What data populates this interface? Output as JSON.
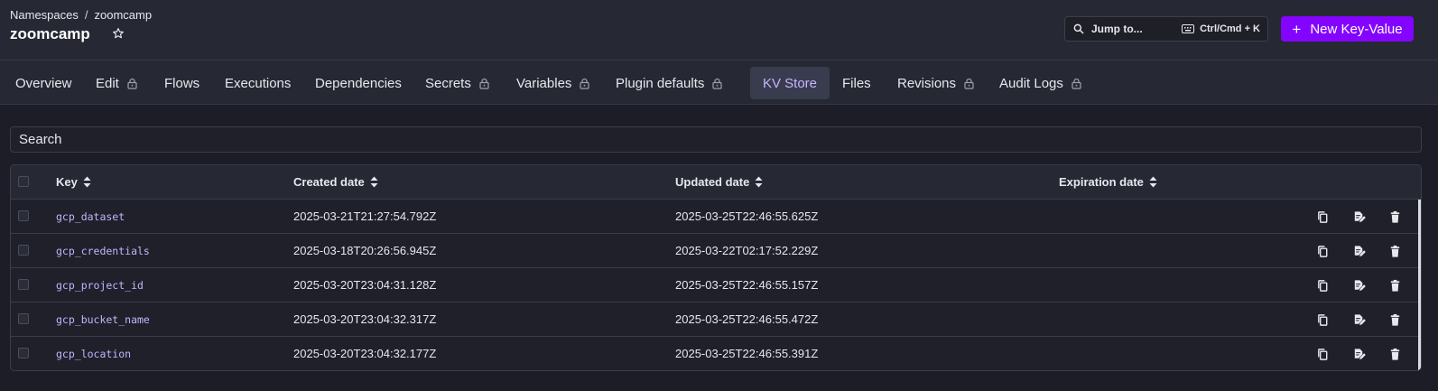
{
  "breadcrumb": {
    "root": "Namespaces",
    "separator": "/",
    "current": "zoomcamp"
  },
  "page": {
    "title": "zoomcamp",
    "favorite_icon": "star-icon"
  },
  "jump": {
    "label": "Jump to...",
    "shortcut": "Ctrl/Cmd + K",
    "icon": "search-icon",
    "keyboard_icon": "keyboard-icon"
  },
  "new_button": {
    "plus": "+",
    "label": "New Key-Value",
    "color": "#8405ff"
  },
  "tabs": [
    {
      "label": "Overview",
      "locked": false
    },
    {
      "label": "Edit",
      "locked": true
    },
    {
      "label": "Flows",
      "locked": false
    },
    {
      "label": "Executions",
      "locked": false
    },
    {
      "label": "Dependencies",
      "locked": false
    },
    {
      "label": "Secrets",
      "locked": true
    },
    {
      "label": "Variables",
      "locked": true
    },
    {
      "label": "Plugin defaults",
      "locked": true
    },
    {
      "label": "KV Store",
      "locked": false,
      "active": true
    },
    {
      "label": "Files",
      "locked": false
    },
    {
      "label": "Revisions",
      "locked": true
    },
    {
      "label": "Audit Logs",
      "locked": true
    }
  ],
  "search": {
    "placeholder": "Search"
  },
  "table": {
    "headers": {
      "key": "Key",
      "created": "Created date",
      "updated": "Updated date",
      "expiration": "Expiration date"
    },
    "rows": [
      {
        "key": "gcp_dataset",
        "created": "2025-03-21T21:27:54.792Z",
        "updated": "2025-03-25T22:46:55.625Z",
        "expiration": ""
      },
      {
        "key": "gcp_credentials",
        "created": "2025-03-18T20:26:56.945Z",
        "updated": "2025-03-22T02:17:52.229Z",
        "expiration": ""
      },
      {
        "key": "gcp_project_id",
        "created": "2025-03-20T23:04:31.128Z",
        "updated": "2025-03-25T22:46:55.157Z",
        "expiration": ""
      },
      {
        "key": "gcp_bucket_name",
        "created": "2025-03-20T23:04:32.317Z",
        "updated": "2025-03-25T22:46:55.472Z",
        "expiration": ""
      },
      {
        "key": "gcp_location",
        "created": "2025-03-20T23:04:32.177Z",
        "updated": "2025-03-25T22:46:55.391Z",
        "expiration": ""
      }
    ],
    "row_actions": [
      "copy-icon",
      "edit-icon",
      "delete-icon"
    ]
  },
  "colors": {
    "accent": "#8405ff",
    "active_tab_text": "#c7b3ff",
    "key_text": "#c4b3ff"
  }
}
